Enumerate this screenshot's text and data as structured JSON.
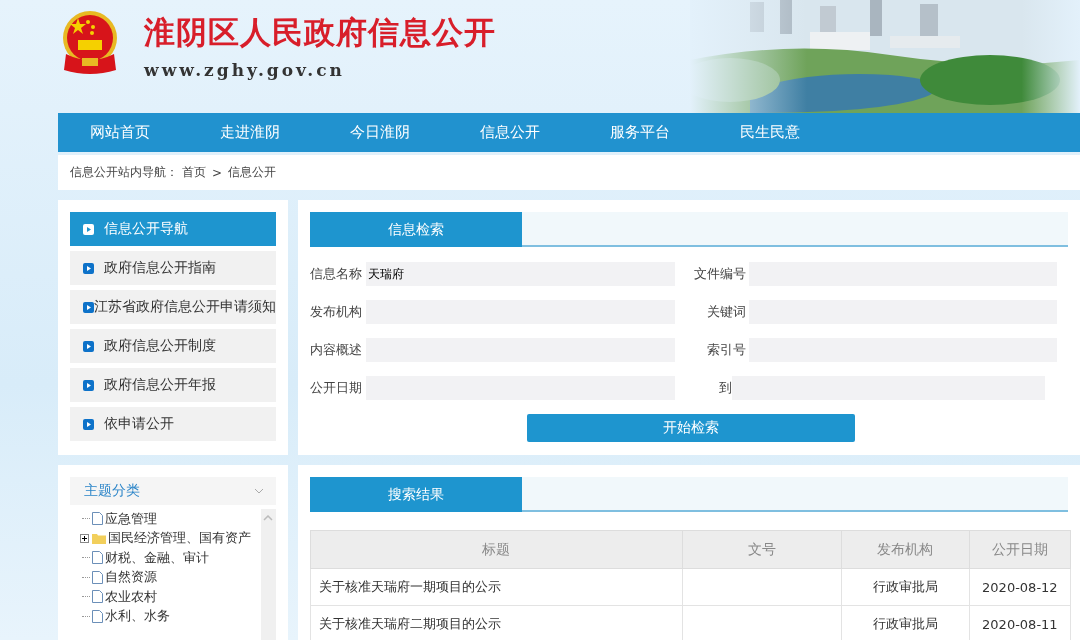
{
  "header": {
    "title": "淮阴区人民政府信息公开",
    "url": "www.zghy.gov.cn"
  },
  "nav": [
    "网站首页",
    "走进淮阴",
    "今日淮阴",
    "信息公开",
    "服务平台",
    "民生民意"
  ],
  "breadcrumb": {
    "label": "信息公开站内导航：",
    "path": [
      "首页",
      "信息公开"
    ],
    "separator": ">"
  },
  "sidebar": {
    "items": [
      {
        "label": "信息公开导航",
        "selected": true
      },
      {
        "label": "政府信息公开指南",
        "selected": false
      },
      {
        "label": "江苏省政府信息公开申请须知",
        "selected": false
      },
      {
        "label": "政府信息公开制度",
        "selected": false
      },
      {
        "label": "政府信息公开年报",
        "selected": false
      },
      {
        "label": "依申请公开",
        "selected": false
      }
    ]
  },
  "topics": {
    "title": "主题分类",
    "items": [
      {
        "label": "应急管理",
        "kind": "page"
      },
      {
        "label": "国民经济管理、国有资产",
        "kind": "folder",
        "expanded": false
      },
      {
        "label": "财税、金融、审计",
        "kind": "page"
      },
      {
        "label": "自然资源",
        "kind": "page"
      },
      {
        "label": "农业农村",
        "kind": "page"
      },
      {
        "label": "水利、水务",
        "kind": "page"
      }
    ]
  },
  "search": {
    "tab": "信息检索",
    "fields": [
      {
        "label": "信息名称",
        "value": "天瑞府"
      },
      {
        "label": "文件编号"
      },
      {
        "label": "发布机构"
      },
      {
        "label": "关键词"
      },
      {
        "label": "内容概述"
      },
      {
        "label": "索引号"
      },
      {
        "label": "公开日期"
      },
      {
        "label": "到"
      }
    ],
    "button": "开始检索"
  },
  "results": {
    "tab": "搜索结果",
    "columns": [
      "标题",
      "文号",
      "发布机构",
      "公开日期"
    ],
    "rows": [
      [
        "关于核准天瑞府一期项目的公示",
        "",
        "行政审批局",
        "2020-08-12"
      ],
      [
        "关于核准天瑞府二期项目的公示",
        "",
        "行政审批局",
        "2020-08-11"
      ]
    ]
  }
}
